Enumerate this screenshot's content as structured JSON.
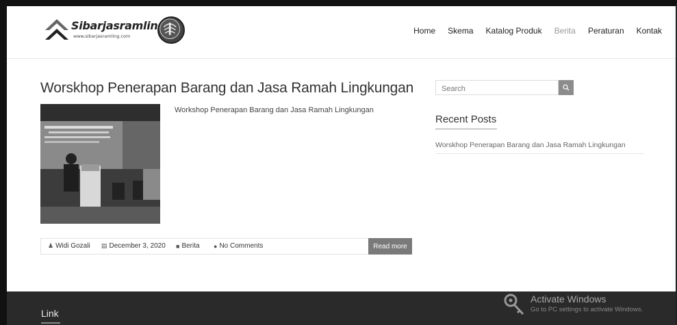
{
  "header": {
    "logo": {
      "title": "Sibarjasramling",
      "url": "www.sibarjasramling.com"
    },
    "nav": [
      {
        "label": "Home"
      },
      {
        "label": "Skema"
      },
      {
        "label": "Katalog Produk"
      },
      {
        "label": "Berita"
      },
      {
        "label": "Peraturan"
      },
      {
        "label": "Kontak"
      }
    ]
  },
  "post": {
    "title": "Worskhop Penerapan Barang dan Jasa Ramah Lingkungan",
    "excerpt": "Workshop Penerapan Barang dan Jasa Ramah Lingkungan",
    "thumbnail_icon": "photo-thumbnail",
    "meta": {
      "author": "Widi Gozali",
      "date": "December 3, 2020",
      "category": "Berita",
      "comments": "No Comments"
    },
    "read_more": "Read more"
  },
  "sidebar": {
    "search_placeholder": "Search",
    "recent_title": "Recent Posts",
    "recent_posts": [
      {
        "label": "Worskhop Penerapan Barang dan Jasa Ramah Lingkungan"
      }
    ]
  },
  "footer": {
    "title": "Link"
  },
  "windows_watermark": {
    "title": "Activate Windows",
    "subtitle": "Go to PC settings to activate Windows."
  },
  "colors": {
    "footer_bg": "#2a2a2a",
    "read_more_bg": "#7a7a7a",
    "search_btn_bg": "#8c8c8c"
  }
}
